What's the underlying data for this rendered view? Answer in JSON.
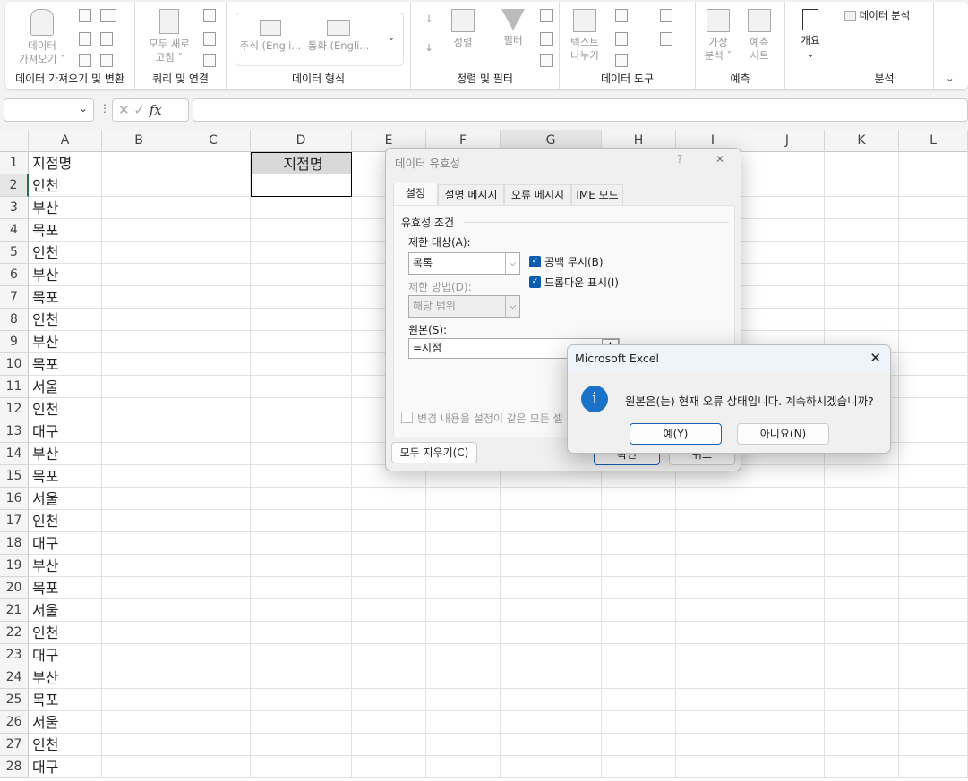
{
  "ribbon": {
    "get_data": "데이터\n가져오기 ˅",
    "group_get": "데이터 가져오기 및 변환",
    "refresh_all": "모두 새로\n고침 ˅",
    "group_query": "쿼리 및 연결",
    "stocks": "주식 (Engli...",
    "currency": "통화 (Engli...",
    "group_types": "데이터 형식",
    "sort": "정렬",
    "filter": "필터",
    "group_sort": "정렬 및 필터",
    "text_to_columns": "텍스트\n나누기",
    "group_tools": "데이터 도구",
    "what_if": "가상\n분석 ˅",
    "forecast_sheet": "예측\n시트",
    "group_forecast": "예측",
    "outline": "개요",
    "data_analysis": "데이터 분석",
    "group_analysis": "분석"
  },
  "formula_bar": {
    "name_box": "",
    "fx": "fx",
    "value": ""
  },
  "sheet": {
    "columns": [
      "A",
      "B",
      "C",
      "D",
      "E",
      "F",
      "G",
      "H",
      "I",
      "J",
      "K",
      "L"
    ],
    "col_a": [
      "지점명",
      "인천",
      "부산",
      "목포",
      "인천",
      "부산",
      "목포",
      "인천",
      "부산",
      "목포",
      "서울",
      "인천",
      "대구",
      "부산",
      "목포",
      "서울",
      "인천",
      "대구",
      "부산",
      "목포",
      "서울",
      "인천",
      "대구",
      "부산",
      "목포",
      "서울",
      "인천",
      "대구"
    ],
    "d1": "지점명",
    "d2": ""
  },
  "validation_dialog": {
    "title": "데이터 유효성",
    "help": "?",
    "close": "✕",
    "tabs": [
      "설정",
      "설명 메시지",
      "오류 메시지",
      "IME 모드"
    ],
    "section": "유효성 조건",
    "allow_label": "제한 대상(A):",
    "allow_value": "목록",
    "ignore_blank": "공백 무시(B)",
    "ignore_blank_checked": true,
    "dropdown": "드롭다운 표시(I)",
    "dropdown_checked": true,
    "data_label": "제한 방법(D):",
    "data_value": "해당 범위",
    "source_label": "원본(S):",
    "source_value": "=지점",
    "apply_all": "변경 내용을 설정이 같은 모든 셀",
    "apply_all_checked": false,
    "clear_all": "모두 지우기(C)",
    "ok": "확인",
    "cancel": "취소"
  },
  "alert": {
    "title": "Microsoft Excel",
    "close": "✕",
    "message": "원본은(는) 현재 오류 상태입니다. 계속하시겠습니까?",
    "yes": "예(Y)",
    "no": "아니요(N)",
    "icon": "info-icon",
    "icon_color": "#1a73c8"
  }
}
